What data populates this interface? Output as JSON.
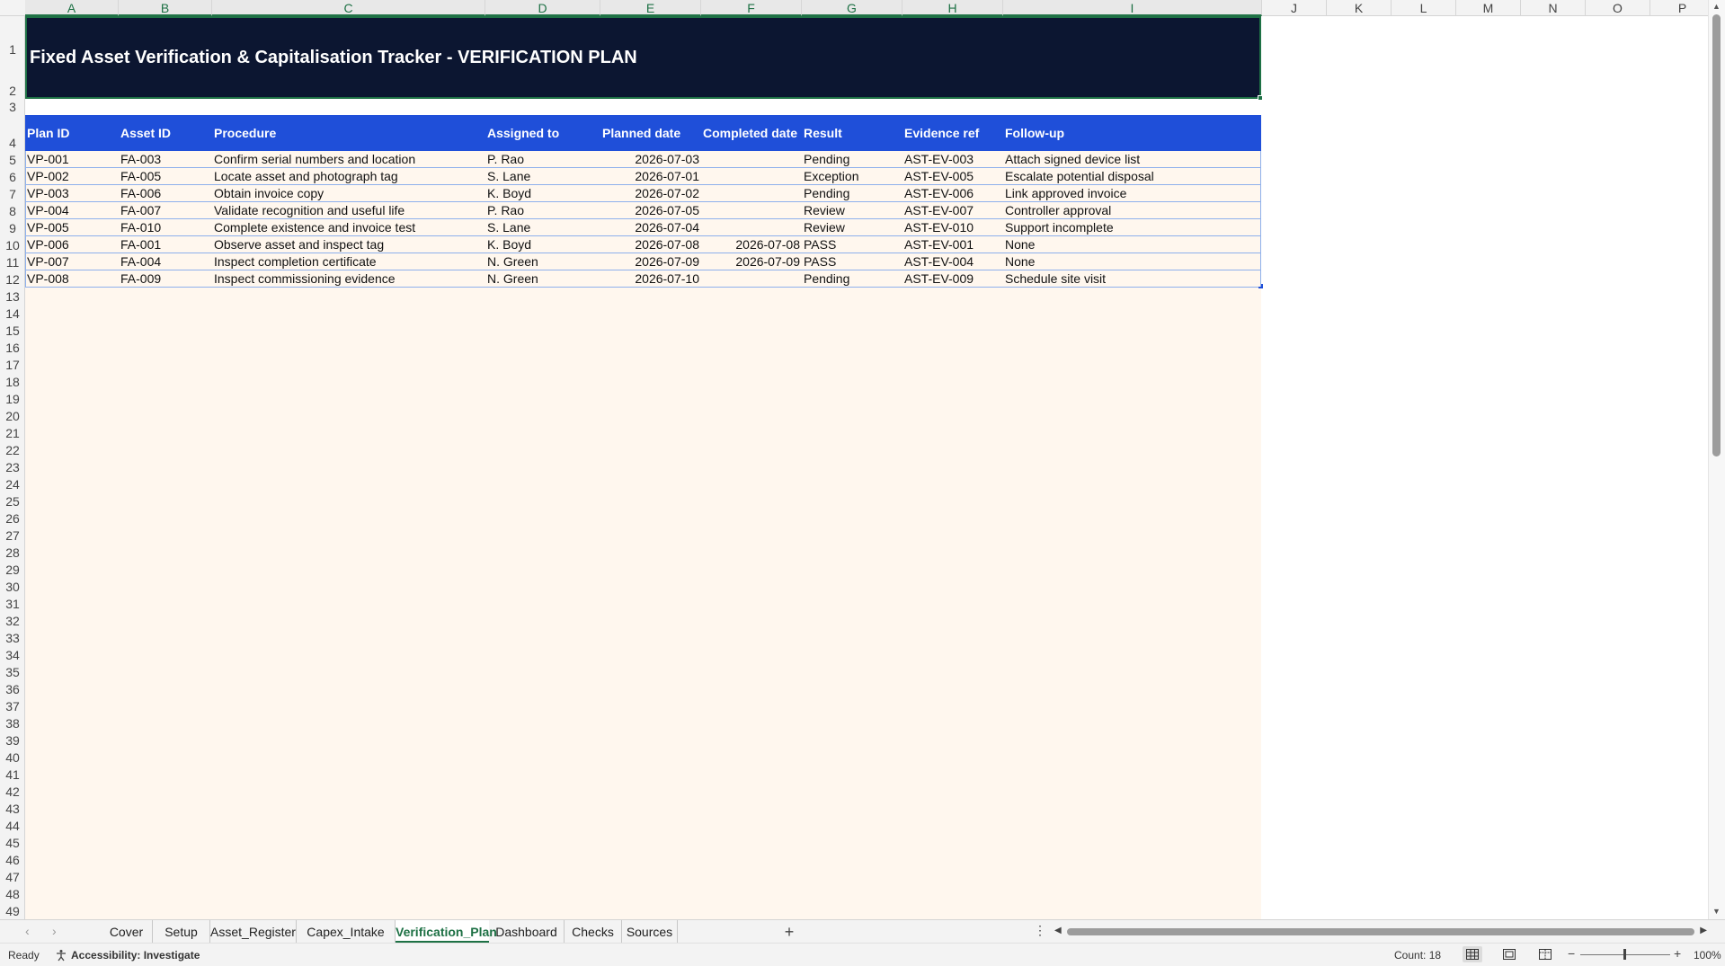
{
  "columns": [
    "A",
    "B",
    "C",
    "D",
    "E",
    "F",
    "G",
    "H",
    "I",
    "J",
    "K",
    "L",
    "M",
    "N",
    "O",
    "P"
  ],
  "rows": [
    "1",
    "2",
    "3",
    "4",
    "5",
    "6",
    "7",
    "8",
    "9",
    "10",
    "11",
    "12",
    "13",
    "14",
    "15",
    "16",
    "17",
    "18",
    "19",
    "20",
    "21",
    "22",
    "23",
    "24",
    "25",
    "26",
    "27",
    "28",
    "29",
    "30",
    "31",
    "32",
    "33",
    "34",
    "35",
    "36",
    "37",
    "38",
    "39",
    "40",
    "41",
    "42",
    "43",
    "44",
    "45",
    "46",
    "47",
    "48",
    "49"
  ],
  "sheet_title": "Fixed Asset Verification & Capitalisation Tracker - VERIFICATION PLAN",
  "table": {
    "headers": [
      "Plan ID",
      "Asset ID",
      "Procedure",
      "Assigned to",
      "Planned date",
      "Completed date",
      "Result",
      "Evidence ref",
      "Follow-up"
    ],
    "rows": [
      [
        "VP-001",
        "FA-003",
        "Confirm serial numbers and location",
        "P. Rao",
        "2026-07-03",
        "",
        "Pending",
        "AST-EV-003",
        "Attach signed device list"
      ],
      [
        "VP-002",
        "FA-005",
        "Locate asset and photograph tag",
        "S. Lane",
        "2026-07-01",
        "",
        "Exception",
        "AST-EV-005",
        "Escalate potential disposal"
      ],
      [
        "VP-003",
        "FA-006",
        "Obtain invoice copy",
        "K. Boyd",
        "2026-07-02",
        "",
        "Pending",
        "AST-EV-006",
        "Link approved invoice"
      ],
      [
        "VP-004",
        "FA-007",
        "Validate recognition and useful life",
        "P. Rao",
        "2026-07-05",
        "",
        "Review",
        "AST-EV-007",
        "Controller approval"
      ],
      [
        "VP-005",
        "FA-010",
        "Complete existence and invoice test",
        "S. Lane",
        "2026-07-04",
        "",
        "Review",
        "AST-EV-010",
        "Support incomplete"
      ],
      [
        "VP-006",
        "FA-001",
        "Observe asset and inspect tag",
        "K. Boyd",
        "2026-07-08",
        "2026-07-08",
        "PASS",
        "AST-EV-001",
        "None"
      ],
      [
        "VP-007",
        "FA-004",
        "Inspect completion certificate",
        "N. Green",
        "2026-07-09",
        "2026-07-09",
        "PASS",
        "AST-EV-004",
        "None"
      ],
      [
        "VP-008",
        "FA-009",
        "Inspect commissioning evidence",
        "N. Green",
        "2026-07-10",
        "",
        "Pending",
        "AST-EV-009",
        "Schedule site visit"
      ]
    ]
  },
  "sheet_tabs": [
    "Cover",
    "Setup",
    "Asset_Register",
    "Capex_Intake",
    "Verification_Plan",
    "Dashboard",
    "Checks",
    "Sources"
  ],
  "active_tab": "Verification_Plan",
  "status": {
    "ready": "Ready",
    "accessibility": "Accessibility: Investigate",
    "count": "Count: 18",
    "zoom": "100%"
  },
  "icons": {
    "add_sheet": "plus-icon",
    "more": "vertical-ellipsis-icon",
    "accessibility": "accessibility-icon"
  },
  "colors": {
    "title_bg": "#0c1631",
    "header_bg": "#1f4fd9",
    "sheet_bg": "#fff7ee",
    "accent": "#1e7145"
  }
}
